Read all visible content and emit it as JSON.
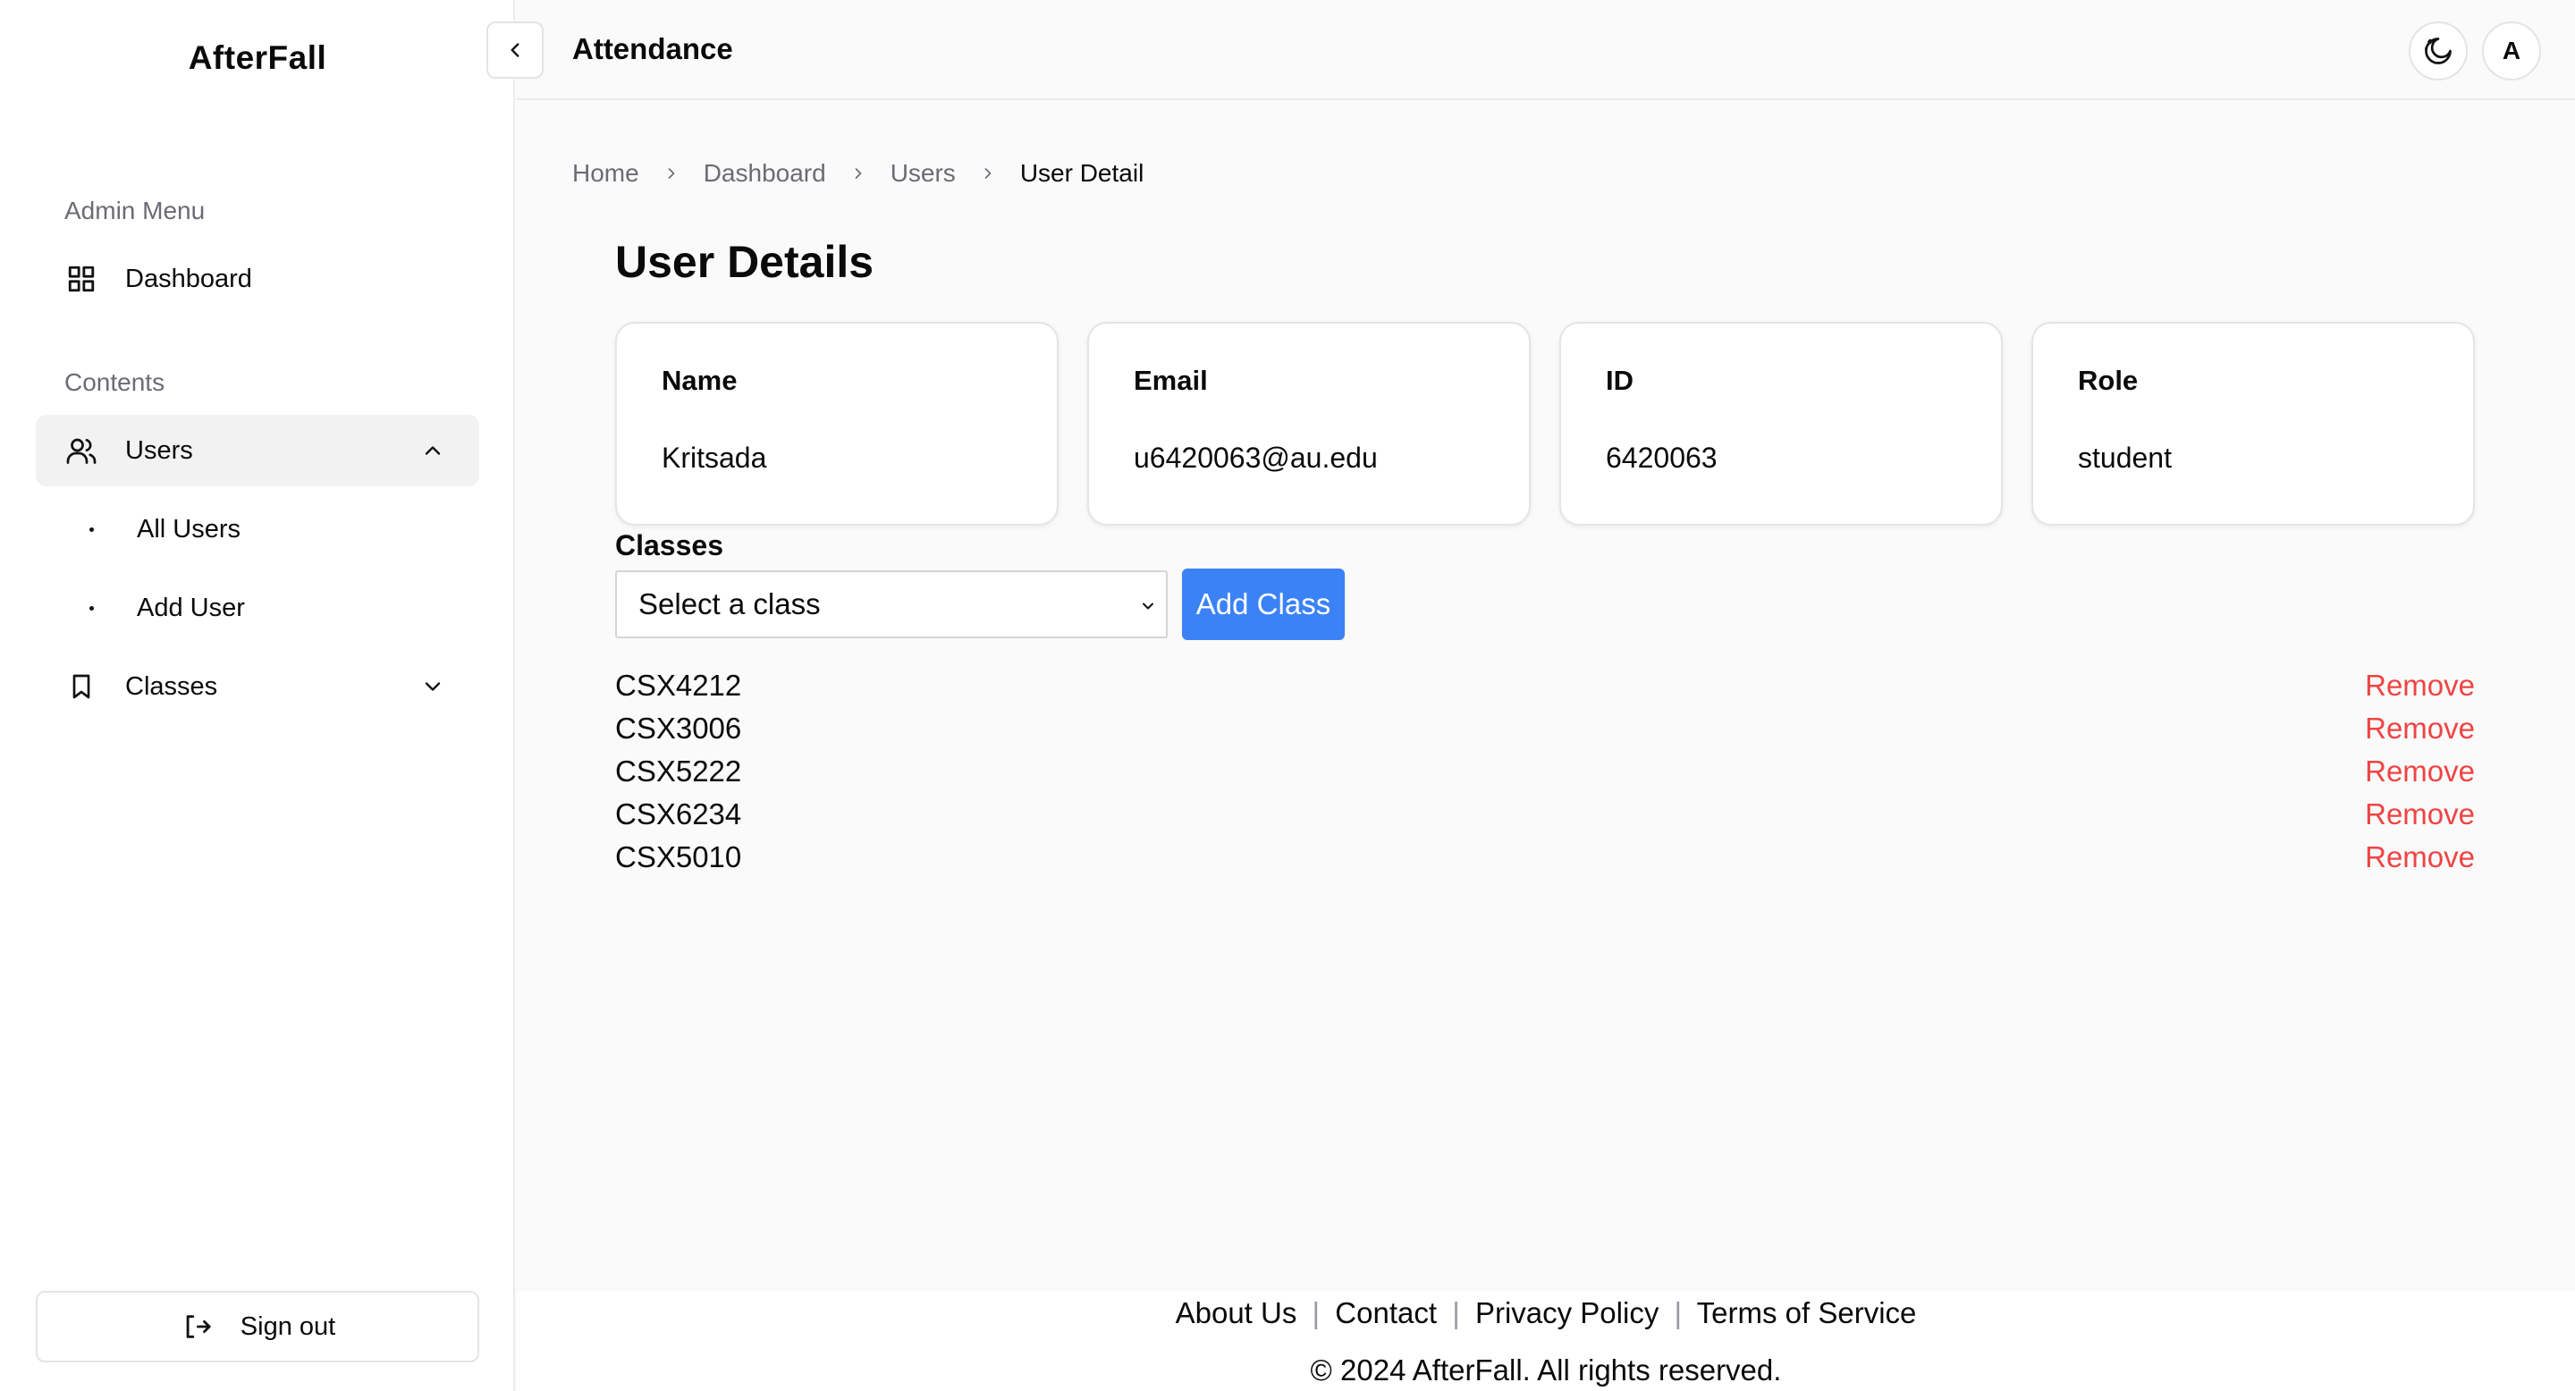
{
  "sidebar": {
    "brand": "AfterFall",
    "admin_menu_label": "Admin Menu",
    "dashboard_label": "Dashboard",
    "contents_label": "Contents",
    "users_label": "Users",
    "users_children": [
      "All Users",
      "Add User"
    ],
    "classes_label": "Classes",
    "sign_out_label": "Sign out"
  },
  "header": {
    "title": "Attendance",
    "avatar_initial": "A"
  },
  "breadcrumb": [
    "Home",
    "Dashboard",
    "Users",
    "User Detail"
  ],
  "page_title": "User Details",
  "cards": [
    {
      "label": "Name",
      "value": "Kritsada"
    },
    {
      "label": "Email",
      "value": "u6420063@au.edu"
    },
    {
      "label": "ID",
      "value": "6420063"
    },
    {
      "label": "Role",
      "value": "student"
    }
  ],
  "classes": {
    "label": "Classes",
    "select_value": "Select a class",
    "add_button": "Add Class",
    "remove_label": "Remove",
    "items": [
      "CSX4212",
      "CSX3006",
      "CSX5222",
      "CSX6234",
      "CSX5010"
    ]
  },
  "footer": {
    "links": [
      "About Us",
      "Contact",
      "Privacy Policy",
      "Terms of Service"
    ],
    "separator": "|",
    "copyright": "© 2024 AfterFall. All rights reserved."
  },
  "colors": {
    "accent": "#3b82f6",
    "danger": "#ef4444",
    "muted": "#6b6b73"
  }
}
